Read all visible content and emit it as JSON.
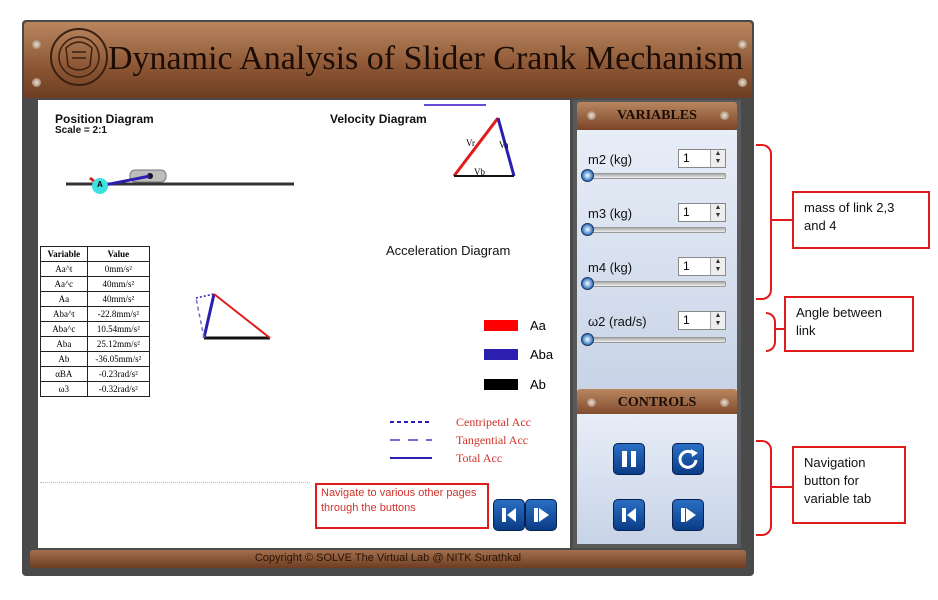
{
  "title": "Dynamic Analysis of Slider Crank Mechanism",
  "content": {
    "position_heading": "Position Diagram",
    "scale": "Scale = 2:1",
    "velocity_heading": "Velocity Diagram",
    "acceleration_heading": "Acceleration Diagram",
    "point_a": "A",
    "velocity_labels": {
      "vr": "Vr",
      "va": "Va",
      "vb": "Vb"
    },
    "table": {
      "headers": [
        "Variable",
        "Value"
      ],
      "rows": [
        [
          "Aa^t",
          "0mm/s²"
        ],
        [
          "Aa^c",
          "40mm/s²"
        ],
        [
          "Aa",
          "40mm/s²"
        ],
        [
          "Aba^t",
          "-22.8mm/s²"
        ],
        [
          "Aba^c",
          "10.54mm/s²"
        ],
        [
          "Aba",
          "25.12mm/s²"
        ],
        [
          "Ab",
          "-36.05mm/s²"
        ],
        [
          "αBA",
          "-0.23rad/s²"
        ],
        [
          "ω3",
          "-0.32rad/s²"
        ]
      ]
    },
    "legend": [
      {
        "label": "Aa",
        "color": "#ff0000"
      },
      {
        "label": "Aba",
        "color": "#2b1fb0"
      },
      {
        "label": "Ab",
        "color": "#000000"
      }
    ],
    "line_legend": [
      {
        "label": "Centripetal Acc",
        "style": "dotted",
        "color": "#2b1fb0"
      },
      {
        "label": "Tangential Acc",
        "style": "dashed",
        "color": "#7a6ad0"
      },
      {
        "label": "Total Acc",
        "style": "solid",
        "color": "#2b1fb0"
      }
    ],
    "nav_note": "Navigate to various other pages through the buttons"
  },
  "variables": {
    "header": "VARIABLES",
    "items": [
      {
        "label": "m2 (kg)",
        "value": "1"
      },
      {
        "label": "m3 (kg)",
        "value": "1"
      },
      {
        "label": "m4 (kg)",
        "value": "1"
      },
      {
        "label": "ω2 (rad/s)",
        "value": "1"
      }
    ]
  },
  "controls": {
    "header": "CONTROLS"
  },
  "footer": "Copyright © SOLVE The Virtual Lab @ NITK Surathkal",
  "annotations": {
    "mass": "mass of link 2,3 and 4",
    "angle": "Angle between link",
    "navigation": "Navigation button for variable tab"
  },
  "colors": {
    "accent_red": "#e01b1b",
    "button_blue": "#1553a8",
    "bronze": "#8c5634"
  }
}
